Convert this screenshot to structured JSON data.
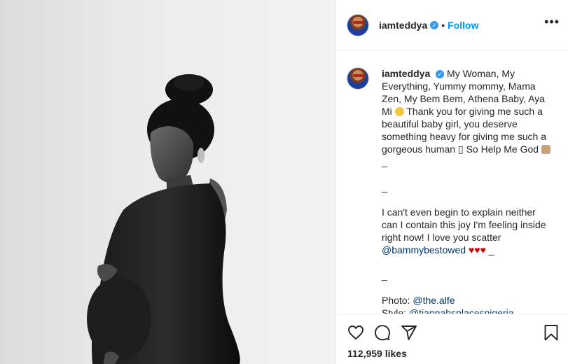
{
  "post": {
    "username": "iamteddya",
    "follow_label": "Follow",
    "more_label": "•••",
    "separator": "•"
  },
  "caption": {
    "username": "iamteddya",
    "paragraph1": "My Woman, My Everything, Yummy mommy, Mama Zen, My Bem Bem, Athena Baby, Aya Mi",
    "paragraph1b": "Thank you for giving me such a beautiful baby girl, you deserve something heavy for giving me such a gorgeous human",
    "glyph": "▯",
    "paragraph1c": "So Help Me God",
    "underscore": "_",
    "separator1": "_",
    "paragraph2": "I can't even begin to explain neither can I contain this joy I'm feeling inside right now! I love you scatter",
    "mention1": "@bammybestowed",
    "hearts": "♥♥♥",
    "separator2": "_",
    "photo_label": "Photo:",
    "mention2": "@the.alfe",
    "style_label": "Style:",
    "mention3": "@tiannahsplacesnigeria"
  },
  "likes": {
    "count": "112,959",
    "label": "likes"
  },
  "icons": {
    "like": "heart-outline-icon",
    "comment": "comment-bubble-icon",
    "share": "paper-plane-icon",
    "save": "bookmark-icon"
  },
  "colors": {
    "link": "#00376b",
    "follow": "#0095f6",
    "verified": "#3897f0",
    "heart": "#d20000"
  }
}
